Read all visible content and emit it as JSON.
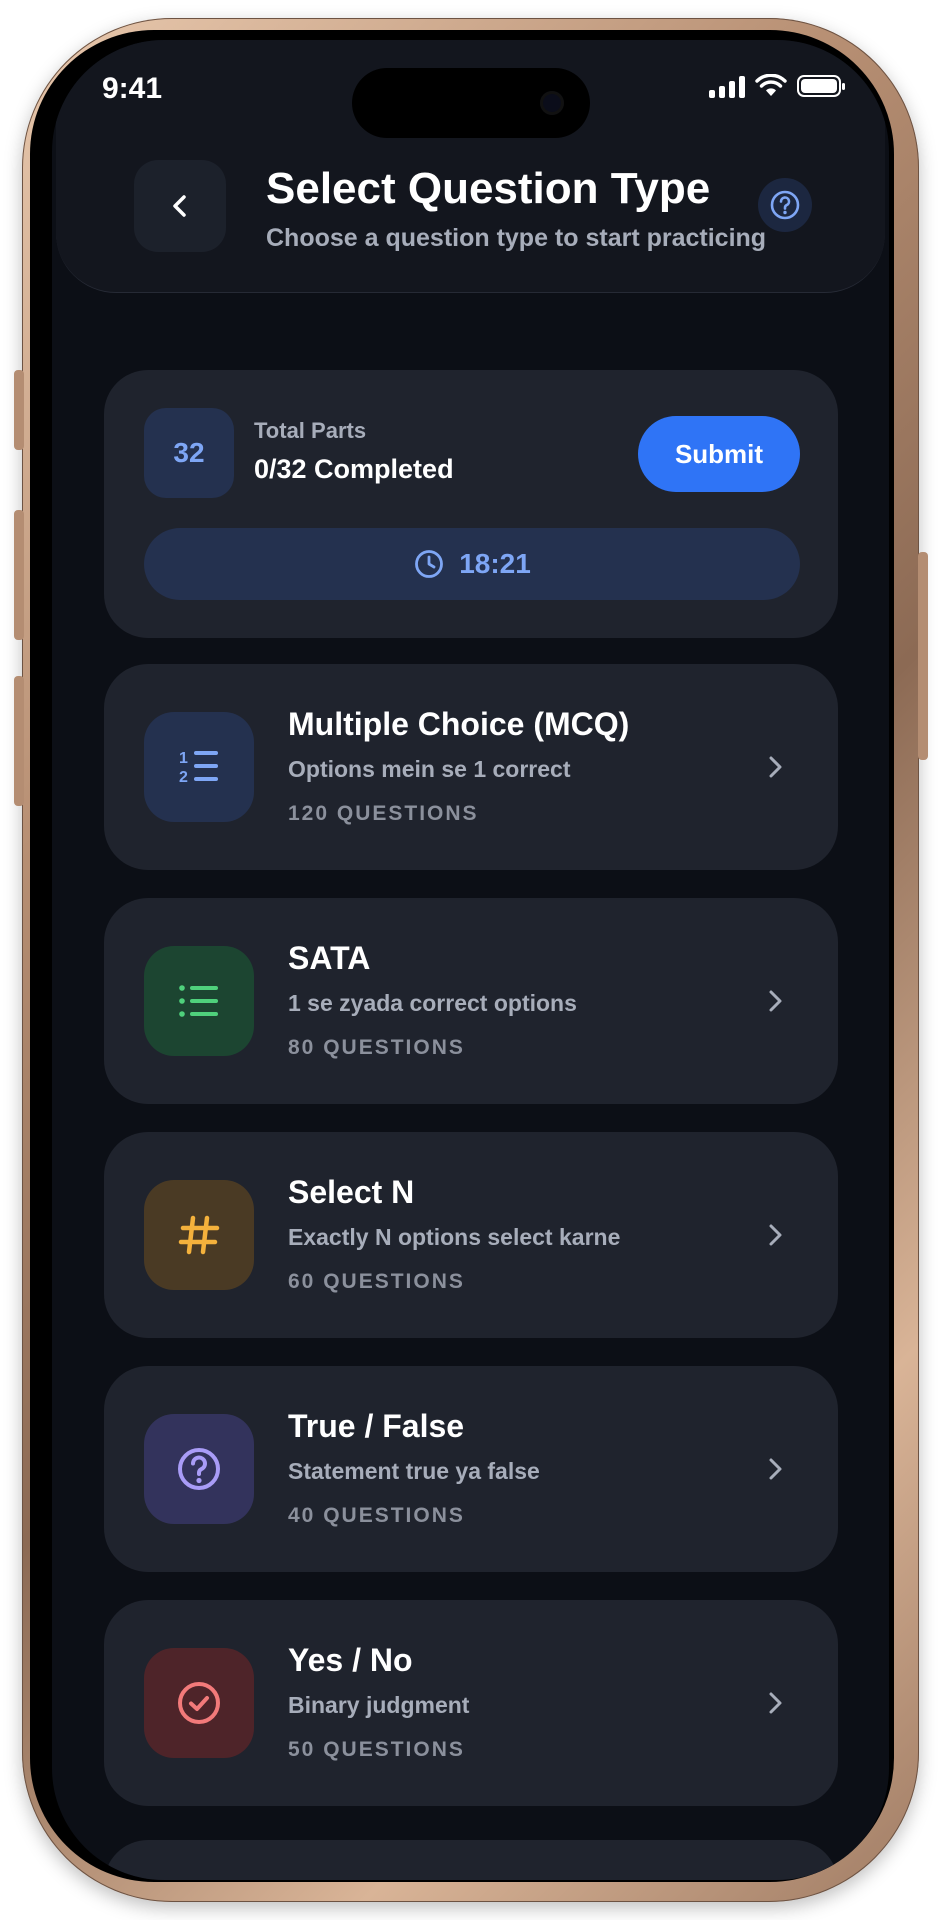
{
  "status_bar": {
    "time": "9:41"
  },
  "header": {
    "title": "Select Question Type",
    "subtitle": "Choose a question type to start practicing"
  },
  "progress": {
    "total_parts_count": "32",
    "label": "Total Parts",
    "completed": "0/32 Completed",
    "submit_label": "Submit",
    "timer": "18:21"
  },
  "question_types": [
    {
      "title": "Multiple Choice (MCQ)",
      "description": "Options mein se 1 correct",
      "count": "120 QUESTIONS",
      "icon": "numbered-list-icon",
      "color": "#7ea6f5"
    },
    {
      "title": "SATA",
      "description": "1 se zyada correct options",
      "count": "80 QUESTIONS",
      "icon": "bullet-list-icon",
      "color": "#4fd17c"
    },
    {
      "title": "Select N",
      "description": "Exactly N options select karne",
      "count": "60 QUESTIONS",
      "icon": "hash-icon",
      "color": "#f4b13c"
    },
    {
      "title": "True / False",
      "description": "Statement true ya false",
      "count": "40 QUESTIONS",
      "icon": "question-circle-icon",
      "color": "#a99cf7"
    },
    {
      "title": "Yes / No",
      "description": "Binary judgment",
      "count": "50 QUESTIONS",
      "icon": "check-circle-icon",
      "color": "#f27a7a"
    }
  ]
}
